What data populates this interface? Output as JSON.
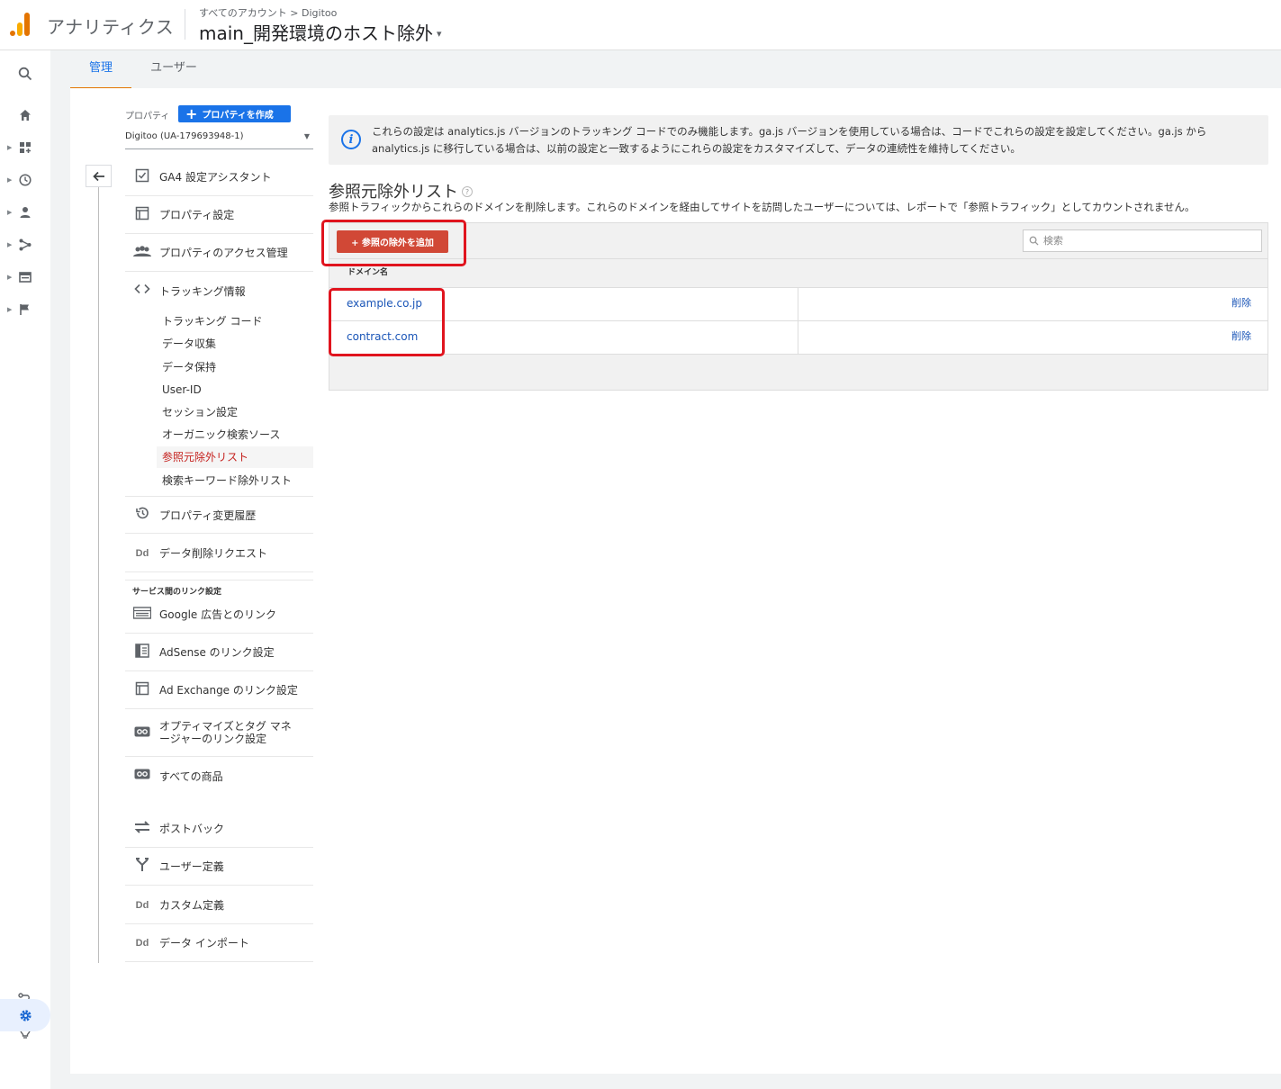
{
  "header": {
    "app_name": "アナリティクス",
    "breadcrumb": "すべてのアカウント > Digitoo",
    "property_title": "main_開発環境のホスト除外",
    "caret": "▾"
  },
  "rail": {
    "icons": [
      "search-icon",
      "home-icon",
      "dashboard-icon",
      "clock-icon",
      "person-icon",
      "acquisition-icon",
      "behavior-icon",
      "flag-icon",
      "route-icon",
      "lightbulb-icon",
      "gear-icon"
    ]
  },
  "tabs": [
    {
      "label": "管理"
    },
    {
      "label": "ユーザー"
    }
  ],
  "property": {
    "label": "プロパティ",
    "create_button": "プロパティを作成",
    "selected": "Digitoo (UA-179693948-1)"
  },
  "menu": {
    "ga4": "GA4 設定アシスタント",
    "property_settings": "プロパティ設定",
    "access": "プロパティのアクセス管理",
    "tracking": "トラッキング情報",
    "tracking_sub": [
      "トラッキング コード",
      "データ収集",
      "データ保持",
      "User-ID",
      "セッション設定",
      "オーガニック検索ソース",
      "参照元除外リスト",
      "検索キーワード除外リスト"
    ],
    "history": "プロパティ変更履歴",
    "data_delete": "データ削除リクエスト",
    "link_section": "サービス間のリンク設定",
    "google_ads": "Google 広告とのリンク",
    "adsense": "AdSense のリンク設定",
    "adexchange": "Ad Exchange のリンク設定",
    "optimize": "オプティマイズとタグ マネージャーのリンク設定",
    "all_products": "すべての商品",
    "postback": "ポストバック",
    "user_def": "ユーザー定義",
    "custom_def": "カスタム定義",
    "data_import": "データ インポート",
    "dd_label": "Dd"
  },
  "info": {
    "text": "これらの設定は analytics.js バージョンのトラッキング コードでのみ機能します。ga.js バージョンを使用している場合は、コードでこれらの設定を設定してください。ga.js から analytics.js に移行している場合は、以前の設定と一致するようにこれらの設定をカスタマイズして、データの連続性を維持してください。",
    "icon": "i"
  },
  "page": {
    "heading": "参照元除外リスト",
    "help": "?",
    "description": "参照トラフィックからこれらのドメインを削除します。これらのドメインを経由してサイトを訪問したユーザーについては、レポートで「参照トラフィック」としてカウントされません。"
  },
  "table": {
    "add_button": "+ 参照の除外を追加",
    "search_placeholder": "検索",
    "column_header": "ドメイン名",
    "delete_label": "削除",
    "rows": [
      {
        "domain": "example.co.jp"
      },
      {
        "domain": "contract.com"
      }
    ]
  },
  "colors": {
    "accent_blue": "#1a73e8",
    "tab_underline": "#e37400",
    "add_button": "#d14836",
    "highlight_box": "#e0141e",
    "active_menu_text": "#c5221f"
  }
}
